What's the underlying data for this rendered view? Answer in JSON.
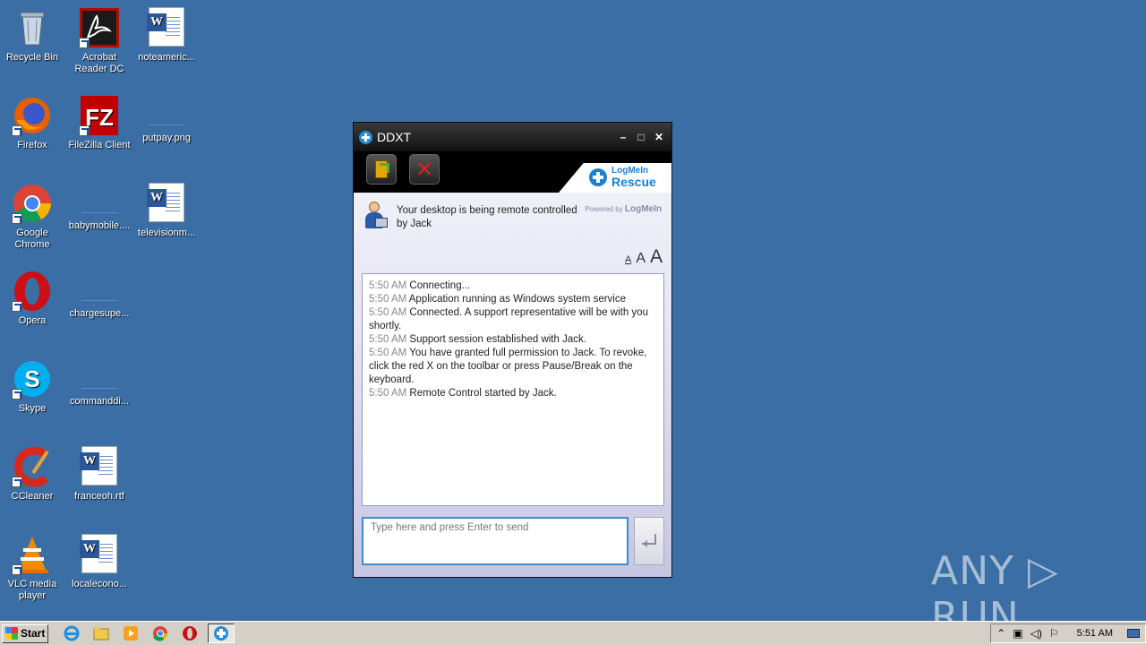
{
  "desktop": {
    "icons": [
      {
        "label": "Recycle Bin",
        "icon": "recycle-bin-icon"
      },
      {
        "label": "Acrobat Reader DC",
        "icon": "acrobat-icon"
      },
      {
        "label": "noteameric...",
        "icon": "word-doc-icon"
      },
      {
        "label": "Firefox",
        "icon": "firefox-icon"
      },
      {
        "label": "FileZilla Client",
        "icon": "filezilla-icon"
      },
      {
        "label": "putpay.png",
        "icon": "file-icon"
      },
      {
        "label": "Google Chrome",
        "icon": "chrome-icon"
      },
      {
        "label": "babymobile....",
        "icon": "file-icon"
      },
      {
        "label": "televisionm...",
        "icon": "word-doc-icon"
      },
      {
        "label": "Opera",
        "icon": "opera-icon"
      },
      {
        "label": "chargesupe...",
        "icon": "file-icon"
      },
      {
        "label": "Skype",
        "icon": "skype-icon"
      },
      {
        "label": "commanddi...",
        "icon": "file-icon"
      },
      {
        "label": "CCleaner",
        "icon": "ccleaner-icon"
      },
      {
        "label": "franceoh.rtf",
        "icon": "word-doc-icon"
      },
      {
        "label": "VLC media player",
        "icon": "vlc-icon"
      },
      {
        "label": "localecono...",
        "icon": "word-doc-icon"
      }
    ]
  },
  "window": {
    "title": "DDXT",
    "minimize": "–",
    "maximize": "□",
    "close": "✕",
    "brand_top": "LogMeIn",
    "brand_bottom": "Rescue",
    "status_line1": "Your desktop is being remote controlled",
    "status_line2": "by Jack",
    "powered_by": "Powered by",
    "powered_brand": "LogMeIn",
    "font_small": "A",
    "font_medium": "A",
    "font_large": "A",
    "messages": [
      {
        "time": "5:50 AM",
        "text": "Connecting..."
      },
      {
        "time": "5:50 AM",
        "text": "Application running as Windows system service"
      },
      {
        "time": "5:50 AM",
        "text": "Connected. A support representative will be with you shortly."
      },
      {
        "time": "5:50 AM",
        "text": "Support session established with Jack."
      },
      {
        "time": "5:50 AM",
        "text": "You have granted full permission to Jack. To revoke, click the red X on the toolbar or press Pause/Break on the keyboard."
      },
      {
        "time": "5:50 AM",
        "text": "Remote Control started by Jack."
      }
    ],
    "input_placeholder": "Type here and press Enter to send",
    "input_value": ""
  },
  "watermark": "ANY ▷ RUN",
  "taskbar": {
    "start_label": "Start",
    "clock": "5:51 AM"
  },
  "colors": {
    "desktop_bg": "#3a6ea5",
    "accent_blue": "#1d7fd0",
    "stop_red": "#e02020"
  }
}
